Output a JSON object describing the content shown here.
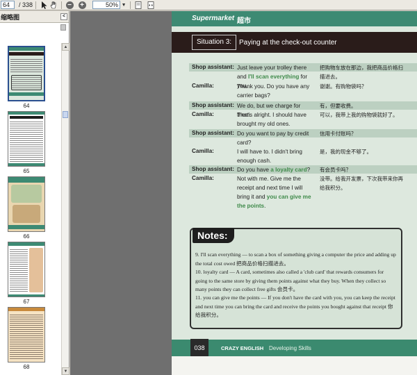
{
  "toolbar": {
    "page_current": "64",
    "page_total": "/ 338",
    "zoom": "50%"
  },
  "sidebar": {
    "title": "缩略图",
    "thumbs": [
      {
        "label": "64"
      },
      {
        "label": "65"
      },
      {
        "label": "66"
      },
      {
        "label": "67"
      },
      {
        "label": "68"
      }
    ]
  },
  "page": {
    "brand": "Supermarket",
    "brand_cn": "超市",
    "situation_label": "Situation 3:",
    "situation_title": "Paying at the check-out counter",
    "dialogue": [
      {
        "speaker": "Shop assistant:",
        "en_plain": "Just leave your trolley there and ",
        "en_green": "I'll scan everything",
        "en_after": " for you.",
        "cn": "把购物车放在那边，我把商品价格扫描进去。"
      },
      {
        "speaker": "Camilla:",
        "en_plain": "Thank you. Do you have any carrier bags?",
        "en_green": "",
        "en_after": "",
        "cn": "谢谢。有购物袋吗？"
      },
      {
        "speaker": "Shop assistant:",
        "en_plain": "We do, but we charge for them.",
        "en_green": "",
        "en_after": "",
        "cn": "有，但要收费。"
      },
      {
        "speaker": "Camilla:",
        "en_plain": "That's alright. I should have brought my old ones.",
        "en_green": "",
        "en_after": "",
        "cn": "可以，我带上我的购物袋就好了。"
      },
      {
        "speaker": "Shop assistant:",
        "en_plain": "Do you want to pay by credit card?",
        "en_green": "",
        "en_after": "",
        "cn": "信用卡付账吗？"
      },
      {
        "speaker": "Camilla:",
        "en_plain": "I will have to. I didn't bring enough cash.",
        "en_green": "",
        "en_after": "",
        "cn": "是，我的现金不够了。"
      },
      {
        "speaker": "Shop assistant:",
        "en_plain": "Do you have ",
        "en_green": "a loyalty card",
        "en_after": "?",
        "cn": "有会员卡吗？"
      },
      {
        "speaker": "Camilla:",
        "en_plain": "Not with me. Give me the receipt and next time I will bring it and ",
        "en_green": "you can give me the points",
        "en_after": ".",
        "cn": "没带。给我开发票，下次我带来你再给我积分。"
      }
    ],
    "notes_title": "Notes:",
    "notes": [
      "9. I'll scan everything — to scan a box of something giving a computer the price and adding up the total cost owed 把商品价格扫描进去。",
      "10. loyalty card — A card, sometimes also called a 'club card' that rewards consumers for going to the same store by giving them points against what they buy. When they collect so many points they can collect free gifts 会员卡。",
      "11. you can give me the points — If you don't have the card with you, you can keep the receipt and next time you can bring the card and receive the points you bought against that receipt 你给我积分。"
    ],
    "page_number": "038",
    "footer_brand": "CRAZY ENGLISH",
    "footer_sub": "Developing Skills"
  }
}
